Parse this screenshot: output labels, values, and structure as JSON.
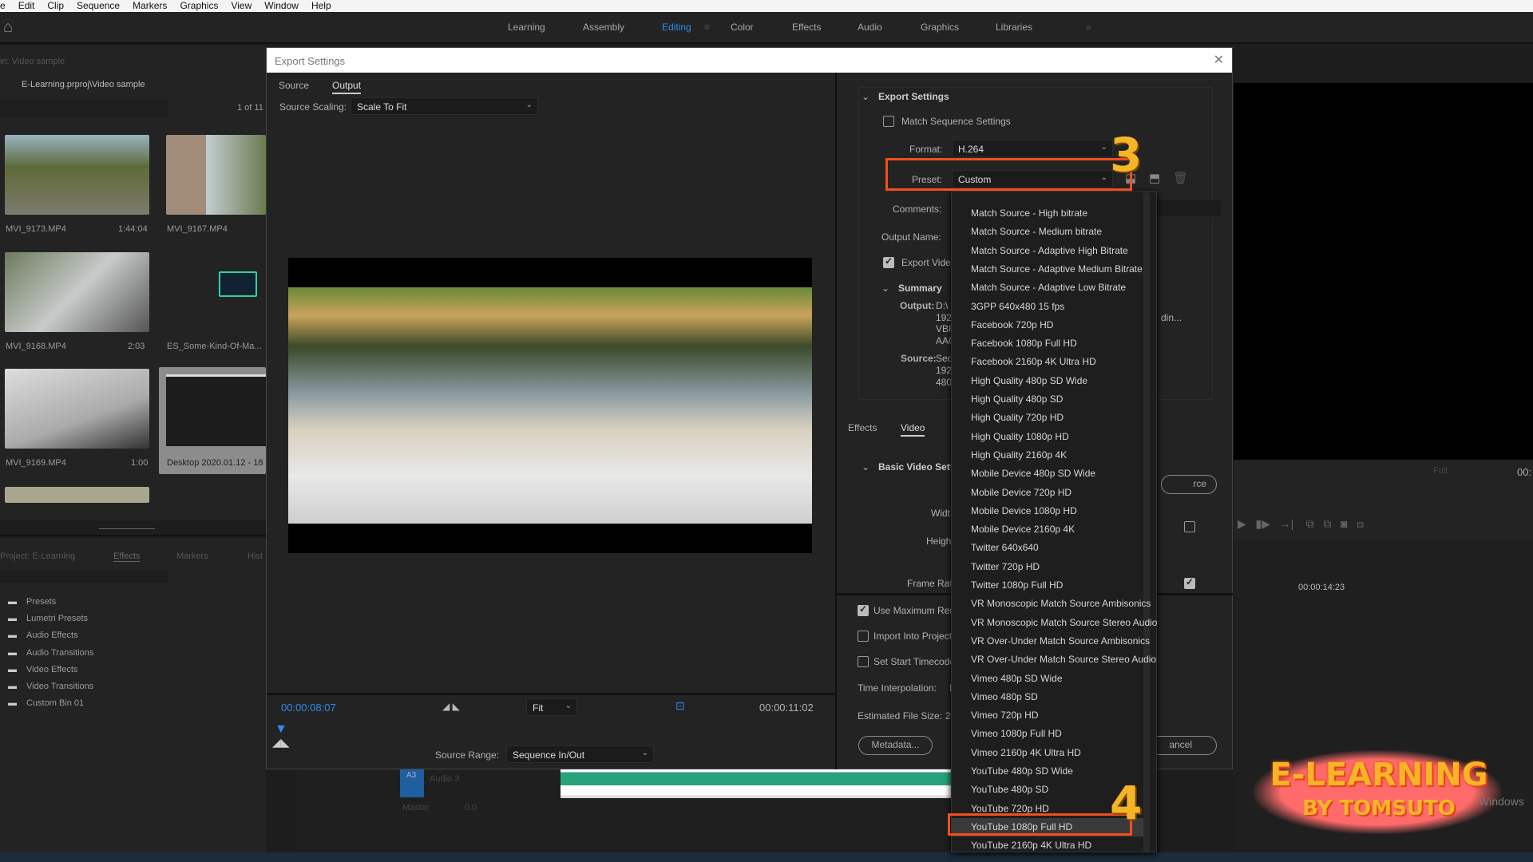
{
  "menu": [
    "e",
    "Edit",
    "Clip",
    "Sequence",
    "Markers",
    "Graphics",
    "View",
    "Window",
    "Help"
  ],
  "workspaces": [
    {
      "label": "Learning"
    },
    {
      "label": "Assembly"
    },
    {
      "label": "Editing",
      "active": true
    },
    {
      "label": "Color"
    },
    {
      "label": "Effects"
    },
    {
      "label": "Audio"
    },
    {
      "label": "Graphics"
    },
    {
      "label": "Libraries"
    }
  ],
  "overflow": "»",
  "bin": {
    "title": "in: Video sample",
    "path": "E-Learning.prproj\\Video sample",
    "count": "1 of 11",
    "clips": [
      {
        "name": "MVI_9173.MP4",
        "duration": "1:44:04"
      },
      {
        "name": "MVI_9167.MP4",
        "duration": ""
      },
      {
        "name": "MVI_9168.MP4",
        "duration": "2:03"
      },
      {
        "name": "ES_Some-Kind-Of-Ma...",
        "duration": ""
      },
      {
        "name": "MVI_9169.MP4",
        "duration": "1:00"
      },
      {
        "name": "Desktop 2020.01.12 - 18",
        "duration": ""
      }
    ]
  },
  "lower_panel": {
    "tabs": [
      "Project: E-Learning",
      "Effects",
      "Markers",
      "Hist"
    ],
    "items": [
      "Presets",
      "Lumetri Presets",
      "Audio Effects",
      "Audio Transitions",
      "Video Effects",
      "Video Transitions",
      "Custom Bin 01"
    ]
  },
  "dialog": {
    "title": "Export Settings",
    "tabs": [
      "Source",
      "Output"
    ],
    "active_tab": "Output",
    "source_scaling_label": "Source Scaling:",
    "source_scaling": "Scale To Fit",
    "current_time": "00:00:08:07",
    "fit": "Fit",
    "duration": "00:00:11:02",
    "source_range_label": "Source Range:",
    "source_range": "Sequence In/Out",
    "export_settings": {
      "heading": "Export Settings",
      "match_sequence": "Match Sequence Settings",
      "match_checked": false,
      "format_label": "Format:",
      "format": "H.264",
      "preset_label": "Preset:",
      "preset": "Custom",
      "comments_label": "Comments:",
      "output_name_label": "Output Name:",
      "export_video": "Export Video",
      "export_video_checked": true,
      "summary": "Summary",
      "output_label": "Output:",
      "output_lines": [
        "D:\\",
        "192",
        "VBF",
        "AAC"
      ],
      "output_trail": "din...",
      "source_label": "Source:",
      "source_lines": [
        "Seq",
        "192",
        "480"
      ]
    },
    "subtabs": [
      "Effects",
      "Video"
    ],
    "active_subtab": "Video",
    "basic_video": "Basic Video Setti",
    "width_label": "Widt",
    "height_label": "Heigh",
    "frame_rate_label": "Frame Rat",
    "match_source_btn": "rce",
    "use_max": "Use Maximum Ren",
    "import_project": "Import Into Project",
    "set_start": "Set Start Timecode",
    "time_interp": "Time Interpolation:",
    "time_interp_val": "F",
    "file_size": "Estimated File Size:",
    "file_size_val": "2",
    "metadata_btn": "Metadata...",
    "cancel_btn": "ancel"
  },
  "preset_list": {
    "current": "Custom",
    "selected": "YouTube 1080p Full HD",
    "items": [
      "Match Source - High bitrate",
      "Match Source - Medium bitrate",
      "Match Source - Adaptive High Bitrate",
      "Match Source - Adaptive Medium Bitrate",
      "Match Source - Adaptive Low Bitrate",
      "3GPP 640x480 15 fps",
      "Facebook 720p HD",
      "Facebook 1080p Full HD",
      "Facebook 2160p 4K Ultra HD",
      "High Quality 480p SD Wide",
      "High Quality 480p SD",
      "High Quality 720p HD",
      "High Quality 1080p HD",
      "High Quality 2160p 4K",
      "Mobile Device 480p SD Wide",
      "Mobile Device 720p HD",
      "Mobile Device 1080p HD",
      "Mobile Device 2160p 4K",
      "Twitter 640x640",
      "Twitter 720p HD",
      "Twitter 1080p Full HD",
      "VR Monoscopic Match Source Ambisonics",
      "VR Monoscopic Match Source Stereo Audio",
      "VR Over-Under Match Source Ambisonics",
      "VR Over-Under Match Source Stereo Audio",
      "Vimeo 480p SD Wide",
      "Vimeo 480p SD",
      "Vimeo 720p HD",
      "Vimeo 1080p Full HD",
      "Vimeo 2160p 4K Ultra HD",
      "YouTube 480p SD Wide",
      "YouTube 480p SD",
      "YouTube 720p HD",
      "YouTube 1080p Full HD",
      "YouTube 2160p 4K Ultra HD"
    ]
  },
  "annotations": {
    "step3": "3",
    "step4": "4",
    "accent": "#f24f1c",
    "number_color": "#f6b526"
  },
  "program": {
    "quality": "Full",
    "timecode": "00:",
    "timeline_time": "00:00:14:23"
  },
  "timeline": {
    "track": "A3",
    "track_name": "Audio 3",
    "master": "Master",
    "master_val": "0.0"
  },
  "watermark": {
    "line1": "E-LEARNING",
    "line2": "BY TOMSUTO",
    "windows": "Windows"
  }
}
